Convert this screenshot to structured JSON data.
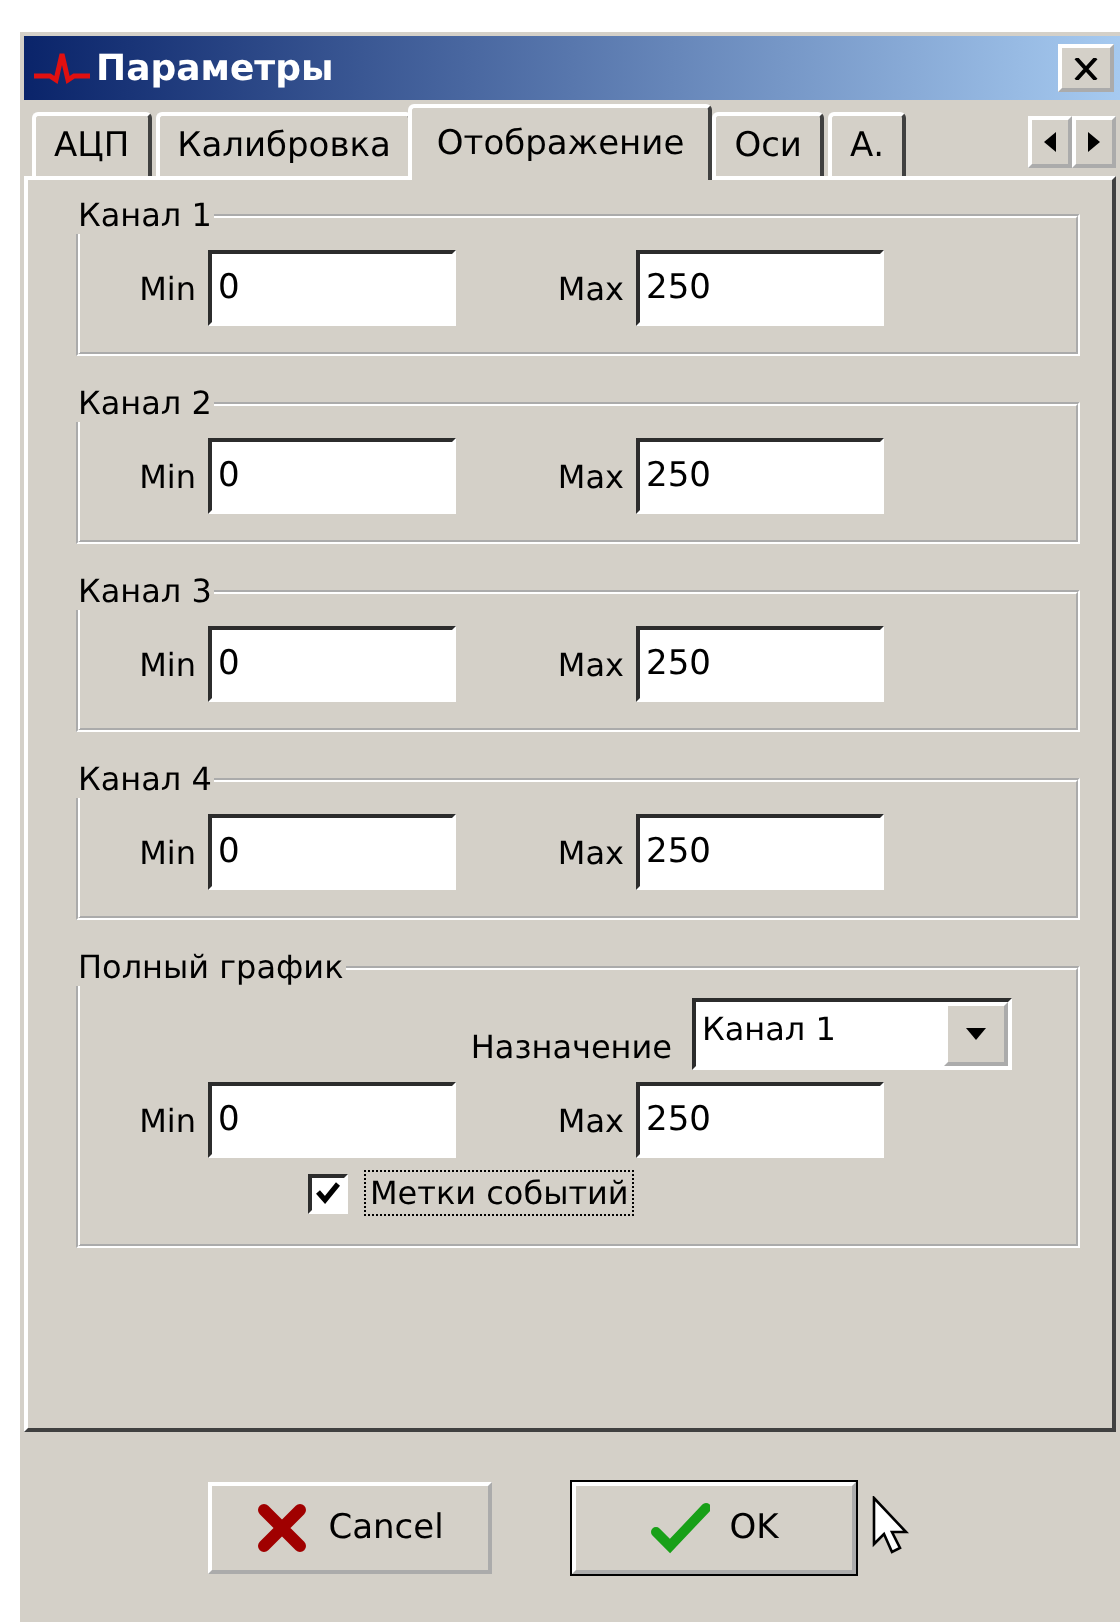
{
  "window": {
    "title": "Параметры"
  },
  "tabs": [
    {
      "label": "АЦП",
      "selected": false
    },
    {
      "label": "Калибровка",
      "selected": false
    },
    {
      "label": "Отображение",
      "selected": true
    },
    {
      "label": "Оси",
      "selected": false
    },
    {
      "label": "А.",
      "selected": false
    }
  ],
  "channels": [
    {
      "title": "Канал 1",
      "min_label": "Min",
      "min": "0",
      "max_label": "Max",
      "max": "250"
    },
    {
      "title": "Канал 2",
      "min_label": "Min",
      "min": "0",
      "max_label": "Max",
      "max": "250"
    },
    {
      "title": "Канал 3",
      "min_label": "Min",
      "min": "0",
      "max_label": "Max",
      "max": "250"
    },
    {
      "title": "Канал 4",
      "min_label": "Min",
      "min": "0",
      "max_label": "Max",
      "max": "250"
    }
  ],
  "full_chart": {
    "title": "Полный график",
    "target_label": "Назначение",
    "target": "Канал 1",
    "min_label": "Min",
    "min": "0",
    "max_label": "Max",
    "max": "250",
    "events_label": "Метки событий",
    "events_checked": true
  },
  "buttons": [
    {
      "label": "Cancel",
      "kind": "cancel",
      "focused": false
    },
    {
      "label": "OK",
      "kind": "ok",
      "focused": true
    }
  ]
}
